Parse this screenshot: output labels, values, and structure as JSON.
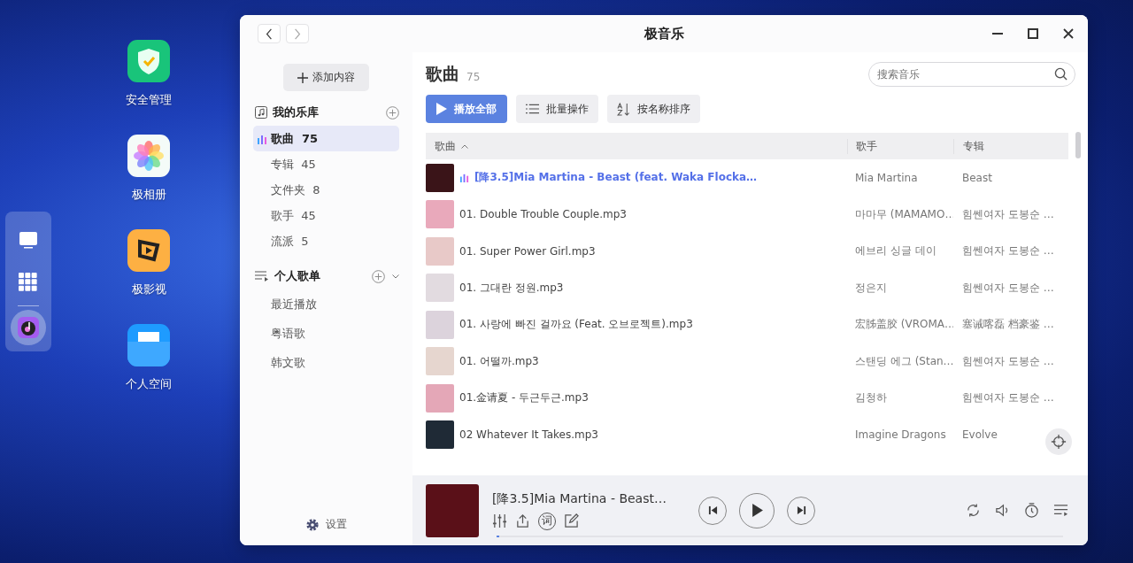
{
  "desktop_icons": [
    {
      "label": "安全管理",
      "kind": "shield"
    },
    {
      "label": "极相册",
      "kind": "photos"
    },
    {
      "label": "极影视",
      "kind": "video"
    },
    {
      "label": "个人空间",
      "kind": "folder"
    }
  ],
  "dock": [
    {
      "kind": "monitor",
      "selected": false
    },
    {
      "kind": "grid",
      "selected": false
    },
    {
      "kind": "music",
      "selected": true
    }
  ],
  "window": {
    "title": "极音乐"
  },
  "sidebar": {
    "add_button": "添加内容",
    "library": {
      "title": "我的乐库",
      "items": [
        {
          "label": "歌曲",
          "count": "75",
          "selected": true
        },
        {
          "label": "专辑",
          "count": "45",
          "selected": false
        },
        {
          "label": "文件夹",
          "count": "8",
          "selected": false
        },
        {
          "label": "歌手",
          "count": "45",
          "selected": false
        },
        {
          "label": "流派",
          "count": "5",
          "selected": false
        }
      ]
    },
    "playlists": {
      "title": "个人歌单",
      "expanded": true,
      "items": [
        {
          "label": "最近播放",
          "selected": false
        },
        {
          "label": "粤语歌",
          "selected": false
        },
        {
          "label": "韩文歌",
          "selected": false
        }
      ]
    },
    "settings": "设置"
  },
  "main": {
    "title": "歌曲",
    "count": "75",
    "search": {
      "placeholder": "搜索音乐"
    },
    "buttons": [
      {
        "label": "播放全部",
        "kind": "play"
      },
      {
        "label": "批量操作",
        "kind": "batch"
      },
      {
        "label": "按名称排序",
        "kind": "sort"
      }
    ],
    "table": {
      "columns": [
        "歌曲",
        "歌手",
        "专辑"
      ],
      "rows": [
        {
          "title": "[降3.5]Mia Martina - Beast (feat. Waka Flocka…",
          "artist": "Mia Martina",
          "album": "Beast",
          "playing": true,
          "color": "#3a1418"
        },
        {
          "title": "01. Double Trouble Couple.mp3",
          "artist": "마마무 (MAMAMO…",
          "album": "힘쎈여자 도봉순 …",
          "playing": false,
          "color": "#e9a9bb"
        },
        {
          "title": "01. Super Power Girl.mp3",
          "artist": "에브리 싱글 데이",
          "album": "힘쎈여자 도봉순 …",
          "playing": false,
          "color": "#e8c9c8"
        },
        {
          "title": "01. 그대란 정원.mp3",
          "artist": "정은지",
          "album": "힘쎈여자 도봉순 …",
          "playing": false,
          "color": "#e2dbe0"
        },
        {
          "title": "01. 사랑에 빠진 걸까요 (Feat. 오브로젝트).mp3",
          "artist": "宏胏盖胶 (VROMA…",
          "album": "塞诫喀磊 档豪鉴 …",
          "playing": false,
          "color": "#dcd3dc"
        },
        {
          "title": "01. 어떨까.mp3",
          "artist": "스탠딩 에그 (Stan…",
          "album": "힘쎈여자 도봉순 …",
          "playing": false,
          "color": "#e6d6cf"
        },
        {
          "title": "01.金请夏 - 두근두근.mp3",
          "artist": "김청하",
          "album": "힘쎈여자 도봉순 …",
          "playing": false,
          "color": "#e4a7b7"
        },
        {
          "title": "02 Whatever It Takes.mp3",
          "artist": "Imagine Dragons",
          "album": "Evolve",
          "playing": false,
          "color": "#1f2a36"
        }
      ]
    }
  },
  "player": {
    "title": "[降3.5]Mia Martina - Beast…",
    "lyrics_label": "词",
    "level": 0.005
  }
}
